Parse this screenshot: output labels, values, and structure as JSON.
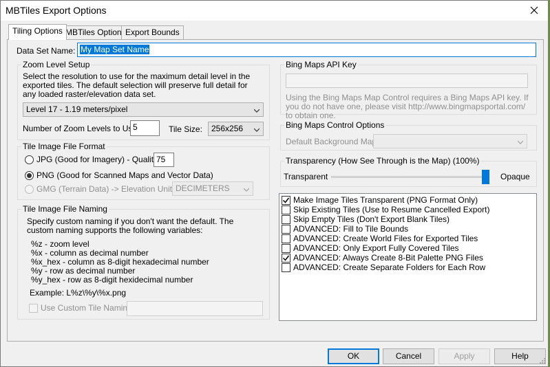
{
  "window": {
    "title": "MBTiles Export Options"
  },
  "tabs": [
    {
      "label": "Tiling Options",
      "active": true
    },
    {
      "label": "MBTiles Options",
      "active": false
    },
    {
      "label": "Export Bounds",
      "active": false
    }
  ],
  "dataset": {
    "label": "Data Set Name:",
    "value": "My Map Set Name"
  },
  "zoom": {
    "group_title": "Zoom Level Setup",
    "description": "Select the resolution to use for the maximum detail level in the exported tiles. The default selection will preserve full detail for any loaded raster/elevation data set.",
    "level_selected": "Level 17 - 1.19 meters/pixel",
    "num_levels_label": "Number of Zoom Levels to Use:",
    "num_levels_value": "5",
    "tile_size_label": "Tile Size:",
    "tile_size_value": "256x256"
  },
  "format": {
    "group_title": "Tile Image File Format",
    "jpg_label": "JPG (Good for Imagery) - Quality ->",
    "jpg_quality": "75",
    "png_label": "PNG (Good for Scanned Maps and Vector Data)",
    "gmg_label": "GMG (Terrain Data) -> Elevation Units",
    "gmg_units": "DECIMETERS",
    "selected": "png"
  },
  "naming": {
    "group_title": "Tile Image File Naming",
    "description": "Specify custom naming if you don't want the default. The custom naming supports the following variables:",
    "variables": [
      "%z - zoom level",
      "%x - column as decimal number",
      "%x_hex - column as 8-digit hexadecimal number",
      "%y - row as decimal number",
      "%y_hex - row as 8-digit hexidecimal number"
    ],
    "example": "Example: L%z\\%y\\%x.png",
    "custom_label": "Use Custom Tile Naming",
    "custom_value": ""
  },
  "bing_api": {
    "group_title": "Bing Maps API Key",
    "key_value": "",
    "note": "Using the Bing Maps Map Control requires a Bing Maps API key. If you do not have one, please visit http://www.bingmapsportal.com/ to obtain one."
  },
  "bing_control": {
    "group_title": "Bing Maps Control Options",
    "bg_map_label": "Default Background Map:",
    "bg_map_value": ""
  },
  "transparency": {
    "group_title": "Transparency (How See Through is the Map) (100%)",
    "left_label": "Transparent",
    "right_label": "Opaque",
    "level": 1.0
  },
  "options": [
    {
      "label": "Make Image Tiles Transparent (PNG Format Only)",
      "checked": true
    },
    {
      "label": "Skip Existing Tiles (Use to Resume Cancelled Export)",
      "checked": false
    },
    {
      "label": "Skip Empty Tiles (Don't Export Blank Tiles)",
      "checked": false
    },
    {
      "label": "ADVANCED: Fill to Tile Bounds",
      "checked": false
    },
    {
      "label": "ADVANCED: Create World Files for Exported Tiles",
      "checked": false
    },
    {
      "label": "ADVANCED: Only Export Fully Covered Tiles",
      "checked": false
    },
    {
      "label": "ADVANCED: Always Create 8-Bit Palette PNG Files",
      "checked": true
    },
    {
      "label": "ADVANCED: Create Separate Folders for Each Row",
      "checked": false
    }
  ],
  "buttons": {
    "ok": "OK",
    "cancel": "Cancel",
    "apply": "Apply",
    "help": "Help"
  },
  "icons": {
    "close": "close-icon",
    "dropdown": "chevron-down-icon",
    "check": "check-icon"
  }
}
